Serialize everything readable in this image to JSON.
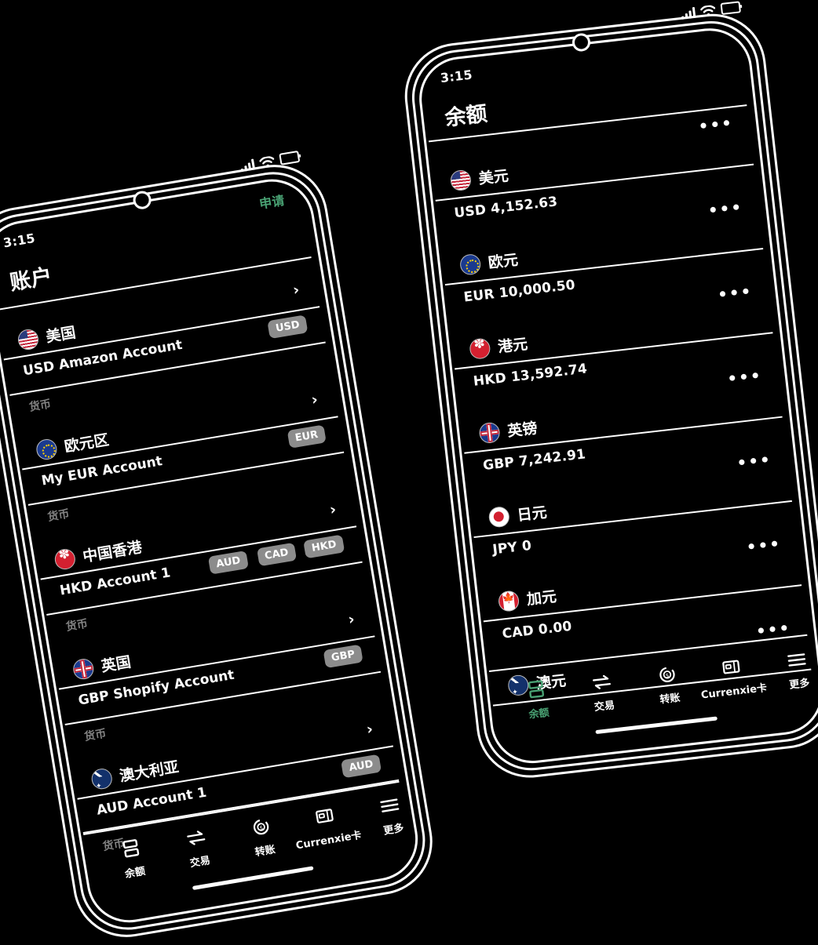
{
  "scene": {
    "background": "#000000",
    "accent_green": "#49a173",
    "badge_gray": "#8c8c8c",
    "sub_label_gray": "#828282"
  },
  "phone_left": {
    "status": {
      "time": "3:15",
      "apply_label": "申请",
      "icons": [
        "signal-icon",
        "wifi-icon",
        "battery-icon"
      ]
    },
    "header": {
      "title": "账户"
    },
    "accounts": [
      {
        "country": "美国",
        "flag": "us",
        "account": "USD Amazon Account",
        "badges": [
          "USD"
        ],
        "sub": "货币"
      },
      {
        "country": "欧元区",
        "flag": "eu",
        "account": "My EUR Account",
        "badges": [
          "EUR"
        ],
        "sub": "货币"
      },
      {
        "country": "中国香港",
        "flag": "hk",
        "account": "HKD Account 1",
        "badges": [
          "AUD",
          "CAD",
          "HKD"
        ],
        "sub": "货币"
      },
      {
        "country": "英国",
        "flag": "gb",
        "account": "GBP Shopify Account",
        "badges": [
          "GBP"
        ],
        "sub": "货币"
      },
      {
        "country": "澳大利亚",
        "flag": "au",
        "account": "AUD Account 1",
        "badges": [
          "AUD"
        ],
        "sub": "货币"
      }
    ],
    "nav": [
      {
        "label": "余额",
        "icon": "balance-icon",
        "active": false
      },
      {
        "label": "交易",
        "icon": "exchange-icon",
        "active": false
      },
      {
        "label": "转账",
        "icon": "transfer-icon",
        "active": false
      },
      {
        "label": "Currenxie卡",
        "icon": "card-icon",
        "active": false
      },
      {
        "label": "更多",
        "icon": "hamburger-icon",
        "active": false
      }
    ]
  },
  "phone_right": {
    "status": {
      "time": "3:15",
      "icons": [
        "signal-icon",
        "wifi-icon",
        "battery-icon"
      ]
    },
    "header": {
      "title": "余额"
    },
    "balances": [
      {
        "currency": "美元",
        "flag": "us",
        "amount": "USD 4,152.63"
      },
      {
        "currency": "欧元",
        "flag": "eu",
        "amount": "EUR 10,000.50"
      },
      {
        "currency": "港元",
        "flag": "hk",
        "amount": "HKD 13,592.74"
      },
      {
        "currency": "英镑",
        "flag": "gb",
        "amount": "GBP 7,242.91"
      },
      {
        "currency": "日元",
        "flag": "jp",
        "amount": "JPY 0"
      },
      {
        "currency": "加元",
        "flag": "ca",
        "amount": "CAD 0.00"
      },
      {
        "currency": "澳元",
        "flag": "au",
        "amount": ""
      }
    ],
    "row_menu_glyph": "•••",
    "nav": [
      {
        "label": "余额",
        "icon": "balance-icon",
        "active": true
      },
      {
        "label": "交易",
        "icon": "exchange-icon",
        "active": false
      },
      {
        "label": "转账",
        "icon": "transfer-icon",
        "active": false
      },
      {
        "label": "Currenxie卡",
        "icon": "card-icon",
        "active": false
      },
      {
        "label": "更多",
        "icon": "hamburger-icon",
        "active": false
      }
    ]
  }
}
